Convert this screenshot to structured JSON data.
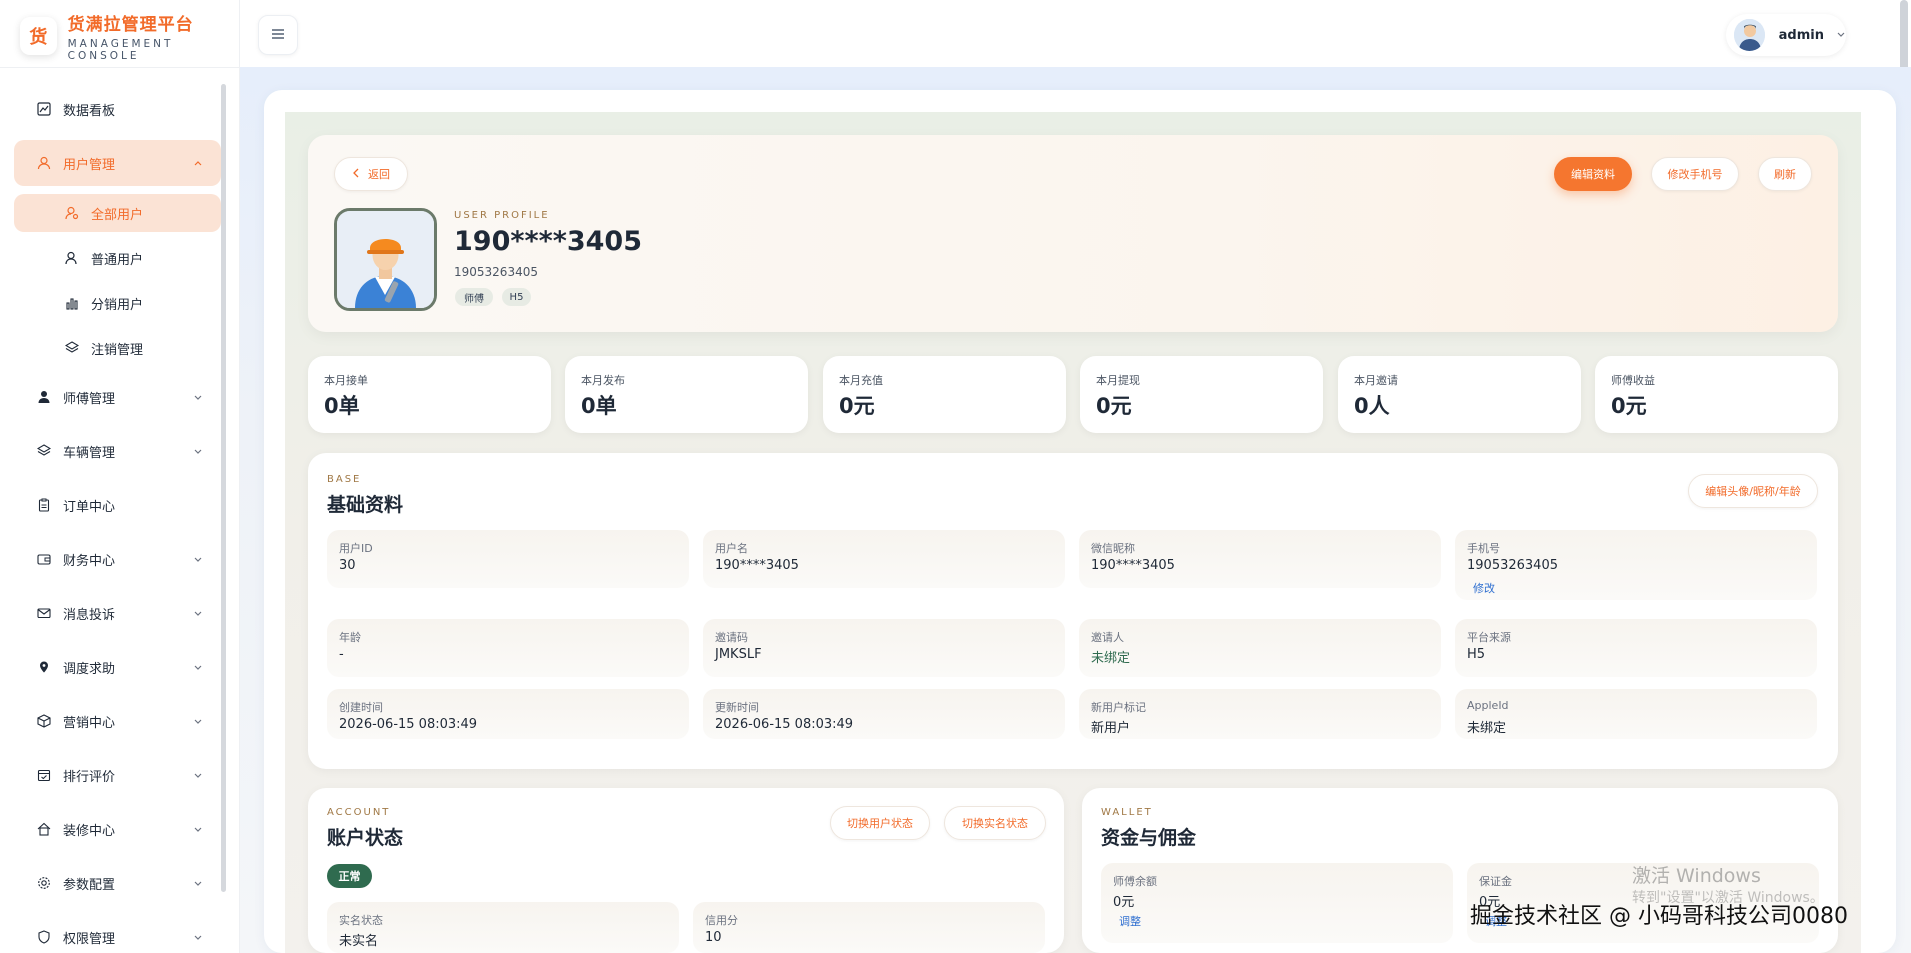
{
  "brand": {
    "logo_char": "货",
    "title": "货满拉管理平台",
    "subtitle": "MANAGEMENT CONSOLE"
  },
  "sidebar": {
    "items": [
      {
        "label": "数据看板",
        "icon": "chart-line-icon"
      },
      {
        "label": "用户管理",
        "icon": "user-icon",
        "expanded": true
      },
      {
        "label": "师傅管理",
        "icon": "person-solid-icon"
      },
      {
        "label": "车辆管理",
        "icon": "layers-icon"
      },
      {
        "label": "订单中心",
        "icon": "clipboard-icon"
      },
      {
        "label": "财务中心",
        "icon": "wallet-icon"
      },
      {
        "label": "消息投诉",
        "icon": "mail-icon"
      },
      {
        "label": "调度求助",
        "icon": "location-pin-icon"
      },
      {
        "label": "营销中心",
        "icon": "box-icon"
      },
      {
        "label": "排行评价",
        "icon": "calendar-check-icon"
      },
      {
        "label": "装修中心",
        "icon": "home-icon"
      },
      {
        "label": "参数配置",
        "icon": "gear-icon"
      },
      {
        "label": "权限管理",
        "icon": "shield-icon"
      }
    ],
    "sub_items": [
      {
        "label": "全部用户",
        "active": true
      },
      {
        "label": "普通用户"
      },
      {
        "label": "分销用户"
      },
      {
        "label": "注销管理"
      }
    ]
  },
  "topbar": {
    "user_name": "admin"
  },
  "profile": {
    "back_label": "返回",
    "edit_label": "编辑资料",
    "change_phone_label": "修改手机号",
    "refresh_label": "刷新",
    "kicker": "USER PROFILE",
    "name": "190****3405",
    "phone": "19053263405",
    "tags": [
      "师傅",
      "H5"
    ]
  },
  "stats": [
    {
      "label": "本月接单",
      "value": "0单"
    },
    {
      "label": "本月发布",
      "value": "0单"
    },
    {
      "label": "本月充值",
      "value": "0元"
    },
    {
      "label": "本月提现",
      "value": "0元"
    },
    {
      "label": "本月邀请",
      "value": "0人"
    },
    {
      "label": "师傅收益",
      "value": "0元"
    }
  ],
  "base": {
    "kicker": "BASE",
    "title": "基础资料",
    "edit_label": "编辑头像/昵称/年龄",
    "fields": [
      {
        "label": "用户ID",
        "value": "30"
      },
      {
        "label": "用户名",
        "value": "190****3405"
      },
      {
        "label": "微信昵称",
        "value": "190****3405"
      },
      {
        "label": "手机号",
        "value": "19053263405",
        "link": "修改"
      },
      {
        "label": "年龄",
        "value": "-"
      },
      {
        "label": "邀请码",
        "value": "JMKSLF"
      },
      {
        "label": "邀请人",
        "value": "未绑定"
      },
      {
        "label": "平台来源",
        "value": "H5"
      },
      {
        "label": "创建时间",
        "value": "2026-06-15 08:03:49"
      },
      {
        "label": "更新时间",
        "value": "2026-06-15 08:03:49"
      },
      {
        "label": "新用户标记",
        "value": "新用户"
      },
      {
        "label": "AppleId",
        "value": "未绑定"
      }
    ]
  },
  "account": {
    "kicker": "ACCOUNT",
    "title": "账户状态",
    "toggle_user_label": "切换用户状态",
    "toggle_real_label": "切换实名状态",
    "status": "正常",
    "fields": [
      {
        "label": "实名状态",
        "value": "未实名"
      },
      {
        "label": "信用分",
        "value": "10"
      }
    ]
  },
  "wallet": {
    "kicker": "WALLET",
    "title": "资金与佣金",
    "fields": [
      {
        "label": "师傅余额",
        "value": "0元",
        "link": "调整"
      },
      {
        "label": "保证金",
        "value": "0元",
        "link": "调整"
      }
    ]
  },
  "overlay": {
    "activate_title": "激活 Windows",
    "activate_sub": "转到\"设置\"以激活 Windows。",
    "watermark": "掘金技术社区 @ 小码哥科技公司0080"
  }
}
